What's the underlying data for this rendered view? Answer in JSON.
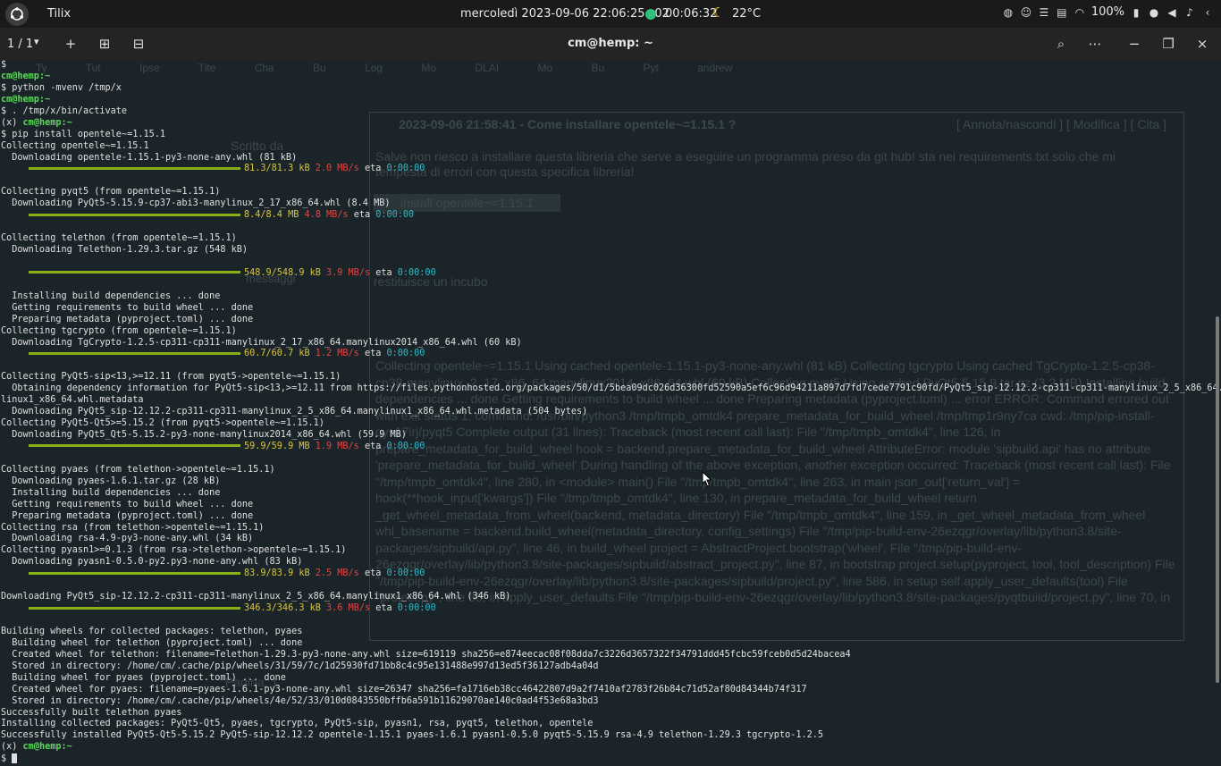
{
  "topbar": {
    "app_name": "Tilix",
    "clock": "mercoledì 2023-09-06 22:06:25+02",
    "timer": "00:06:32",
    "temperature": "22°C",
    "battery": "100%",
    "icons": [
      "activities-icon",
      "moon-icon",
      "globe-icon",
      "emoji-icon",
      "list-icon",
      "clipboard-icon",
      "wifi-icon",
      "battery-icon",
      "mic-icon",
      "volume-icon",
      "bell-icon",
      "chevron-left-icon"
    ]
  },
  "terminal_header": {
    "tab_count": "1 / 1",
    "title": "cm@hemp: ~"
  },
  "background_window": {
    "tabs": "Ty Tut Ipse Tite Cha Bu Log Mo DLAI Mo Bu Pyt andrew",
    "post_header": "2023-09-06 21:58:41 - Come installare opentele~=1.15.1 ?",
    "post_links": "[ Annota/nascondi ] [ Modifica ] [ Cita ]",
    "post_body": "Salve non riesco a installare questa libreria che serve a eseguire un programma preso da git hub! sta nei requirements.txt solo che mi tempesta di errori con questa specifica libreria!",
    "code": "install opentele~=1.15.1",
    "post_body2": "restituisce un incubo",
    "error_text": "Collecting opentele~=1.15.1 Using cached opentele-1.15.1-py3-none-any.whl (81 kB) Collecting tgcrypto Using cached TgCrypto-1.2.5-cp38-cp38-manylinux_2_17_x86_64.manylinux2014_x86_64.whl (60 kB) Collecting pyqt5 Using cached PyQt5-5.15.9.tar.gz (3.2 MB) Installing build dependencies ... done Getting requirements to build wheel ... done Preparing metadata (pyproject.toml) ... error ERROR: Command errored out with exit status 1: command: /usr/bin/python3 /tmp/tmpb_omtdk4 prepare_metadata_for_build_wheel /tmp/tmp1r9ny7ca cwd: /tmp/pip-install-qys17irj/pyqt5 Complete output (31 lines): Traceback (most recent call last): File \"/tmp/tmpb_omtdk4\", line 126, in prepare_metadata_for_build_wheel hook = backend.prepare_metadata_for_build_wheel AttributeError: module 'sipbuild.api' has no attribute 'prepare_metadata_for_build_wheel' During handling of the above exception, another exception occurred: Traceback (most recent call last): File \"/tmp/tmpb_omtdk4\", line 280, in <module> main() File \"/tmp/tmpb_omtdk4\", line 263, in main json_out['return_val'] = hook(**hook_input['kwargs']) File \"/tmp/tmpb_omtdk4\", line 130, in prepare_metadata_for_build_wheel return _get_wheel_metadata_from_wheel(backend, metadata_directory) File \"/tmp/tmpb_omtdk4\", line 159, in _get_wheel_metadata_from_wheel whl_basename = backend.build_wheel(metadata_directory, config_settings) File \"/tmp/pip-build-env-26ezqgr/overlay/lib/python3.8/site-packages/sipbuild/api.py\", line 46, in build_wheel project = AbstractProject.bootstrap('wheel', File \"/tmp/pip-build-env-26ezqgr/overlay/lib/python3.8/site-packages/sipbuild/abstract_project.py\", line 87, in bootstrap project.setup(pyproject, tool, tool_description) File \"/tmp/pip-build-env-26ezqgr/overlay/lib/python3.8/site-packages/sipbuild/project.py\", line 586, in setup self.apply_user_defaults(tool) File \"project.py\", line 66, in apply_user_defaults File \"/tmp/pip-build-env-26ezqgr/overlay/lib/python3.8/site-packages/pyqtbuild/project.py\", line 70, in",
    "side_label": "Scritto da",
    "side_label2": "messaggi",
    "page_label": "Pagina: 1"
  },
  "terminal": {
    "lines": [
      {
        "t": "plain",
        "text": "$"
      },
      {
        "t": "prompt",
        "text": "cm@hemp:~"
      },
      {
        "t": "plain",
        "text": "$ python -mvenv /tmp/x"
      },
      {
        "t": "prompt",
        "text": "cm@hemp:~"
      },
      {
        "t": "plain",
        "text": "$ . /tmp/x/bin/activate"
      },
      {
        "t": "vprompt",
        "pre": "(x) ",
        "text": "cm@hemp:~"
      },
      {
        "t": "plain",
        "text": "$ pip install opentele~=1.15.1"
      },
      {
        "t": "plain",
        "text": "Collecting opentele~=1.15.1"
      },
      {
        "t": "plain",
        "text": "  Downloading opentele-1.15.1-py3-none-any.whl (81 kB)"
      },
      {
        "t": "progress",
        "size": "81.3/81.3 kB",
        "speed": "2.0 MB/s",
        "eta": "0:00:00"
      },
      {
        "t": "plain",
        "text": ""
      },
      {
        "t": "plain",
        "text": "Collecting pyqt5 (from opentele~=1.15.1)"
      },
      {
        "t": "plain",
        "text": "  Downloading PyQt5-5.15.9-cp37-abi3-manylinux_2_17_x86_64.whl (8.4 MB)"
      },
      {
        "t": "progress",
        "size": "8.4/8.4 MB",
        "speed": "4.8 MB/s",
        "eta": "0:00:00"
      },
      {
        "t": "plain",
        "text": ""
      },
      {
        "t": "plain",
        "text": "Collecting telethon (from opentele~=1.15.1)"
      },
      {
        "t": "plain",
        "text": "  Downloading Telethon-1.29.3.tar.gz (548 kB)"
      },
      {
        "t": "plain",
        "text": ""
      },
      {
        "t": "progress",
        "size": "548.9/548.9 kB",
        "speed": "3.9 MB/s",
        "eta": "0:00:00"
      },
      {
        "t": "plain",
        "text": ""
      },
      {
        "t": "plain",
        "text": "  Installing build dependencies ... done"
      },
      {
        "t": "plain",
        "text": "  Getting requirements to build wheel ... done"
      },
      {
        "t": "plain",
        "text": "  Preparing metadata (pyproject.toml) ... done"
      },
      {
        "t": "plain",
        "text": "Collecting tgcrypto (from opentele~=1.15.1)"
      },
      {
        "t": "plain",
        "text": "  Downloading TgCrypto-1.2.5-cp311-cp311-manylinux_2_17_x86_64.manylinux2014_x86_64.whl (60 kB)"
      },
      {
        "t": "progress",
        "size": "60.7/60.7 kB",
        "speed": "1.2 MB/s",
        "eta": "0:00:00"
      },
      {
        "t": "plain",
        "text": ""
      },
      {
        "t": "plain",
        "text": "Collecting PyQt5-sip<13,>=12.11 (from pyqt5->opentele~=1.15.1)"
      },
      {
        "t": "plain",
        "text": "  Obtaining dependency information for PyQt5-sip<13,>=12.11 from https://files.pythonhosted.org/packages/50/d1/5bea09dc026d36300fd52590a5ef6c96d94211a897d7fd7cede7791c90fd/PyQt5_sip-12.12.2-cp311-cp311-manylinux_2_5_x86_64.many"
      },
      {
        "t": "plain",
        "text": "linux1_x86_64.whl.metadata"
      },
      {
        "t": "plain",
        "text": "  Downloading PyQt5_sip-12.12.2-cp311-cp311-manylinux_2_5_x86_64.manylinux1_x86_64.whl.metadata (504 bytes)"
      },
      {
        "t": "plain",
        "text": "Collecting PyQt5-Qt5>=5.15.2 (from pyqt5->opentele~=1.15.1)"
      },
      {
        "t": "plain",
        "text": "  Downloading PyQt5_Qt5-5.15.2-py3-none-manylinux2014_x86_64.whl (59.9 MB)"
      },
      {
        "t": "progress",
        "size": "59.9/59.9 MB",
        "speed": "1.9 MB/s",
        "eta": "0:00:00"
      },
      {
        "t": "plain",
        "text": ""
      },
      {
        "t": "plain",
        "text": "Collecting pyaes (from telethon->opentele~=1.15.1)"
      },
      {
        "t": "plain",
        "text": "  Downloading pyaes-1.6.1.tar.gz (28 kB)"
      },
      {
        "t": "plain",
        "text": "  Installing build dependencies ... done"
      },
      {
        "t": "plain",
        "text": "  Getting requirements to build wheel ... done"
      },
      {
        "t": "plain",
        "text": "  Preparing metadata (pyproject.toml) ... done"
      },
      {
        "t": "plain",
        "text": "Collecting rsa (from telethon->opentele~=1.15.1)"
      },
      {
        "t": "plain",
        "text": "  Downloading rsa-4.9-py3-none-any.whl (34 kB)"
      },
      {
        "t": "plain",
        "text": "Collecting pyasn1>=0.1.3 (from rsa->telethon->opentele~=1.15.1)"
      },
      {
        "t": "plain",
        "text": "  Downloading pyasn1-0.5.0-py2.py3-none-any.whl (83 kB)"
      },
      {
        "t": "progress",
        "size": "83.9/83.9 kB",
        "speed": "2.5 MB/s",
        "eta": "0:00:00"
      },
      {
        "t": "plain",
        "text": ""
      },
      {
        "t": "plain",
        "text": "Downloading PyQt5_sip-12.12.2-cp311-cp311-manylinux_2_5_x86_64.manylinux1_x86_64.whl (346 kB)"
      },
      {
        "t": "progress",
        "size": "346.3/346.3 kB",
        "speed": "3.6 MB/s",
        "eta": "0:00:00"
      },
      {
        "t": "plain",
        "text": ""
      },
      {
        "t": "plain",
        "text": "Building wheels for collected packages: telethon, pyaes"
      },
      {
        "t": "plain",
        "text": "  Building wheel for telethon (pyproject.toml) ... done"
      },
      {
        "t": "plain",
        "text": "  Created wheel for telethon: filename=Telethon-1.29.3-py3-none-any.whl size=619119 sha256=e874eecac08f08dda7c3226d3657322f34791ddd45fcbc59fceb0d5d24bacea4"
      },
      {
        "t": "plain",
        "text": "  Stored in directory: /home/cm/.cache/pip/wheels/31/59/7c/1d25930fd71bb8c4c95e131488e997d13ed5f36127adb4a04d"
      },
      {
        "t": "plain",
        "text": "  Building wheel for pyaes (pyproject.toml) ... done"
      },
      {
        "t": "plain",
        "text": "  Created wheel for pyaes: filename=pyaes-1.6.1-py3-none-any.whl size=26347 sha256=fa1716eb38cc46422807d9a2f7410af2783f26b84c71d52af80d84344b74f317"
      },
      {
        "t": "plain",
        "text": "  Stored in directory: /home/cm/.cache/pip/wheels/4e/52/33/010d0843550bffb6a591b11629070ae140c0ad4f53e68a3bd3"
      },
      {
        "t": "plain",
        "text": "Successfully built telethon pyaes"
      },
      {
        "t": "plain",
        "text": "Installing collected packages: PyQt5-Qt5, pyaes, tgcrypto, PyQt5-sip, pyasn1, rsa, pyqt5, telethon, opentele"
      },
      {
        "t": "plain",
        "text": "Successfully installed PyQt5-Qt5-5.15.2 PyQt5-sip-12.12.2 opentele-1.15.1 pyaes-1.6.1 pyasn1-0.5.0 pyqt5-5.15.9 rsa-4.9 telethon-1.29.3 tgcrypto-1.2.5"
      },
      {
        "t": "vprompt",
        "pre": "(x) ",
        "text": "cm@hemp:~"
      },
      {
        "t": "cursor",
        "text": "$ "
      }
    ]
  }
}
